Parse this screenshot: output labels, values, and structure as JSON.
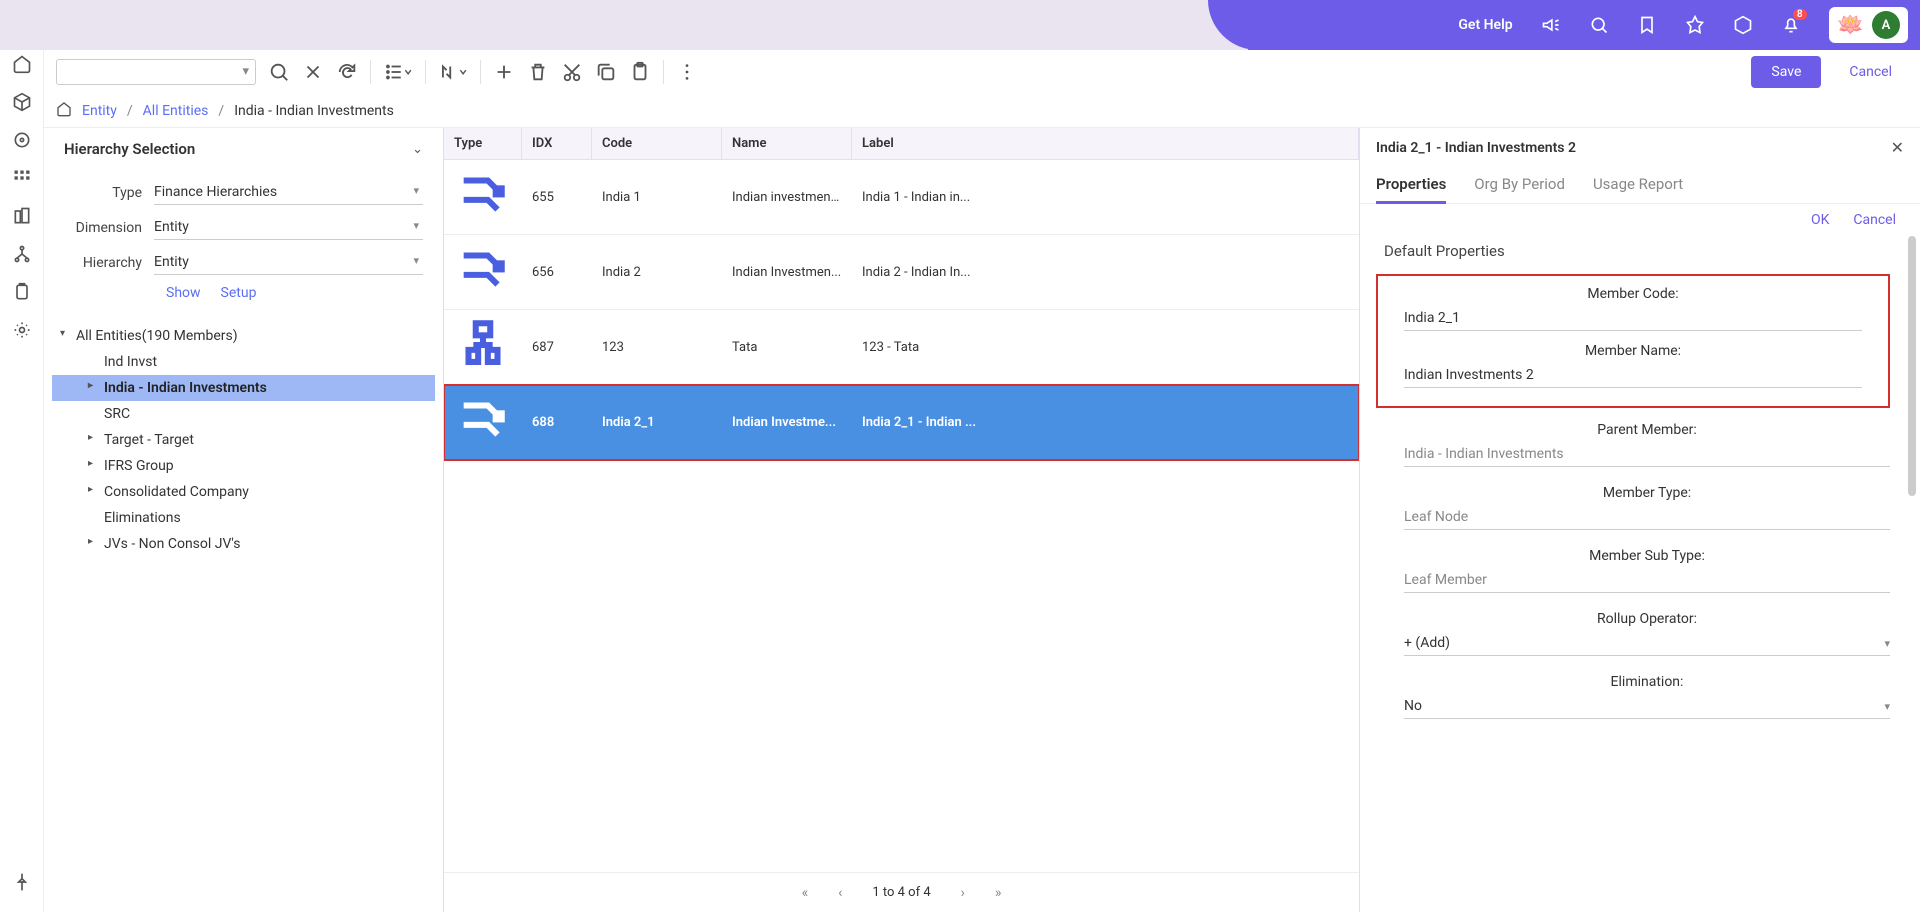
{
  "topbar": {
    "get_help": "Get Help",
    "notif_count": "8",
    "avatar_letter": "A"
  },
  "toolbar": {
    "save": "Save",
    "cancel": "Cancel"
  },
  "breadcrumb": {
    "entity": "Entity",
    "all": "All Entities",
    "current": "India - Indian Investments"
  },
  "hierarchy": {
    "title": "Hierarchy Selection",
    "type_label": "Type",
    "type_value": "Finance Hierarchies",
    "dimension_label": "Dimension",
    "dimension_value": "Entity",
    "hierarchy_label": "Hierarchy",
    "hierarchy_value": "Entity",
    "show": "Show",
    "setup": "Setup"
  },
  "tree": {
    "root": "All Entities(190 Members)",
    "items": [
      {
        "label": "Ind Invst",
        "expandable": false
      },
      {
        "label": "India - Indian Investments",
        "expandable": true,
        "selected": true
      },
      {
        "label": "SRC",
        "expandable": false
      },
      {
        "label": "Target - Target",
        "expandable": true
      },
      {
        "label": "IFRS Group",
        "expandable": true
      },
      {
        "label": "Consolidated Company",
        "expandable": true
      },
      {
        "label": "Eliminations",
        "expandable": false
      },
      {
        "label": "JVs - Non Consol JV's",
        "expandable": true
      }
    ]
  },
  "grid": {
    "headers": {
      "type": "Type",
      "idx": "IDX",
      "code": "Code",
      "name": "Name",
      "label": "Label"
    },
    "rows": [
      {
        "idx": "655",
        "code": "India 1",
        "name": "Indian investment...",
        "label": "India 1 - Indian in..."
      },
      {
        "idx": "656",
        "code": "India 2",
        "name": "Indian Investmen...",
        "label": "India 2 - Indian In..."
      },
      {
        "idx": "687",
        "code": "123",
        "name": "Tata",
        "label": "123 - Tata",
        "alt_icon": true
      },
      {
        "idx": "688",
        "code": "India 2_1",
        "name": "Indian Investme...",
        "label": "India 2_1 - Indian ...",
        "selected": true
      }
    ],
    "pager": "1 to 4 of 4"
  },
  "props": {
    "title": "India 2_1 - Indian Investments 2",
    "tabs": {
      "properties": "Properties",
      "org": "Org By Period",
      "usage": "Usage Report"
    },
    "ok": "OK",
    "cancel": "Cancel",
    "section": "Default Properties",
    "fields": {
      "member_code_label": "Member Code:",
      "member_code": "India 2_1",
      "member_name_label": "Member Name:",
      "member_name": "Indian Investments 2",
      "parent_label": "Parent Member:",
      "parent": "India - Indian Investments",
      "type_label": "Member Type:",
      "type": "Leaf Node",
      "subtype_label": "Member Sub Type:",
      "subtype": "Leaf Member",
      "rollup_label": "Rollup Operator:",
      "rollup": "+ (Add)",
      "elim_label": "Elimination:",
      "elim": "No"
    }
  }
}
